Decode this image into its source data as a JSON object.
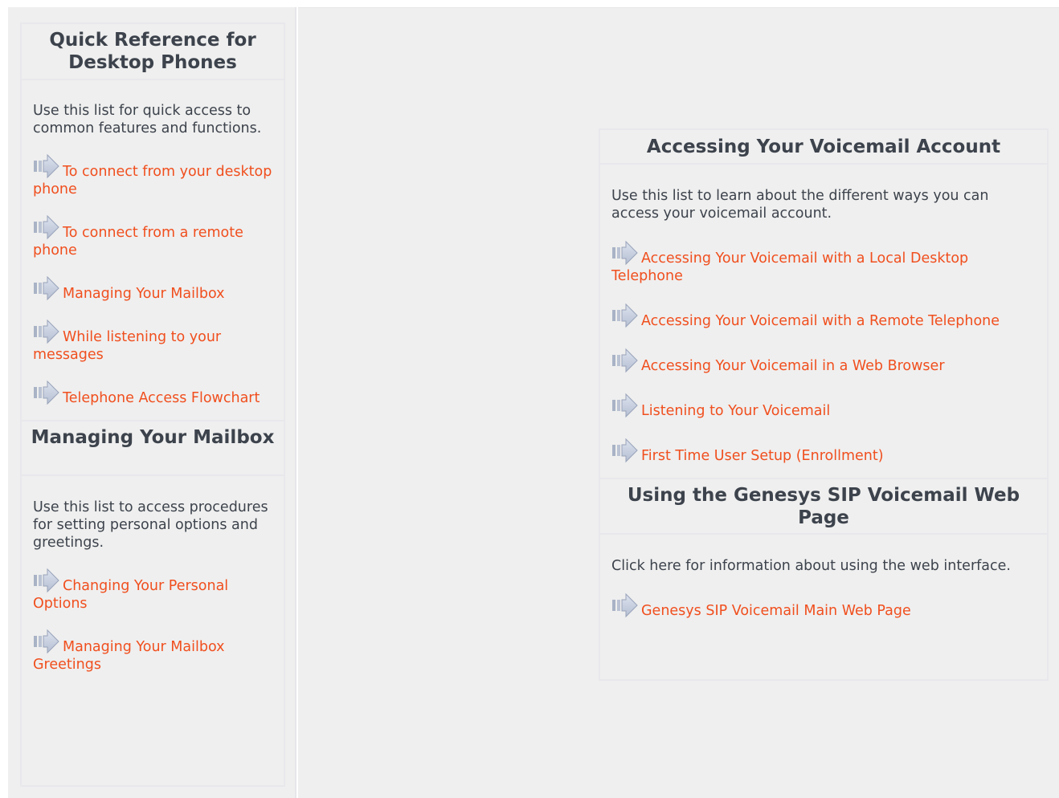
{
  "left": {
    "quick_ref": {
      "title": "Quick Reference for Desktop Phones",
      "description": "Use this list for quick access to common features and functions.",
      "links": [
        {
          "label": "To connect from your desktop phone"
        },
        {
          "label": "To connect from a remote phone"
        },
        {
          "label": "Managing Your Mailbox"
        },
        {
          "label": "While listening to your messages"
        },
        {
          "label": "Telephone Access Flowchart"
        }
      ]
    },
    "managing": {
      "title": "Managing Your Mailbox",
      "description": "Use this list to access procedures for setting personal options and greetings.",
      "links": [
        {
          "label": "Changing Your Personal Options"
        },
        {
          "label": "Managing Your Mailbox Greetings"
        }
      ]
    }
  },
  "right": {
    "accessing": {
      "title": "Accessing Your Voicemail Account",
      "description": "Use this list to learn about the different ways you can access your voicemail account.",
      "links": [
        {
          "label": "Accessing Your Voicemail with a Local Desktop Telephone"
        },
        {
          "label": "Accessing Your Voicemail with a Remote Telephone"
        },
        {
          "label": "Accessing Your Voicemail in a Web Browser"
        },
        {
          "label": "Listening to Your Voicemail"
        },
        {
          "label": "First Time User Setup (Enrollment)"
        }
      ]
    },
    "web": {
      "title": "Using the Genesys SIP Voicemail Web Page",
      "description": "Click here for information about using the web interface.",
      "links": [
        {
          "label": "Genesys SIP Voicemail Main Web Page"
        }
      ]
    }
  },
  "colors": {
    "link": "#f04f1e",
    "text": "#3d434c",
    "panel_bg": "#efefef",
    "border": "#e8e8ec"
  },
  "icons": {
    "link_bullet": "arrow-right-icon"
  }
}
